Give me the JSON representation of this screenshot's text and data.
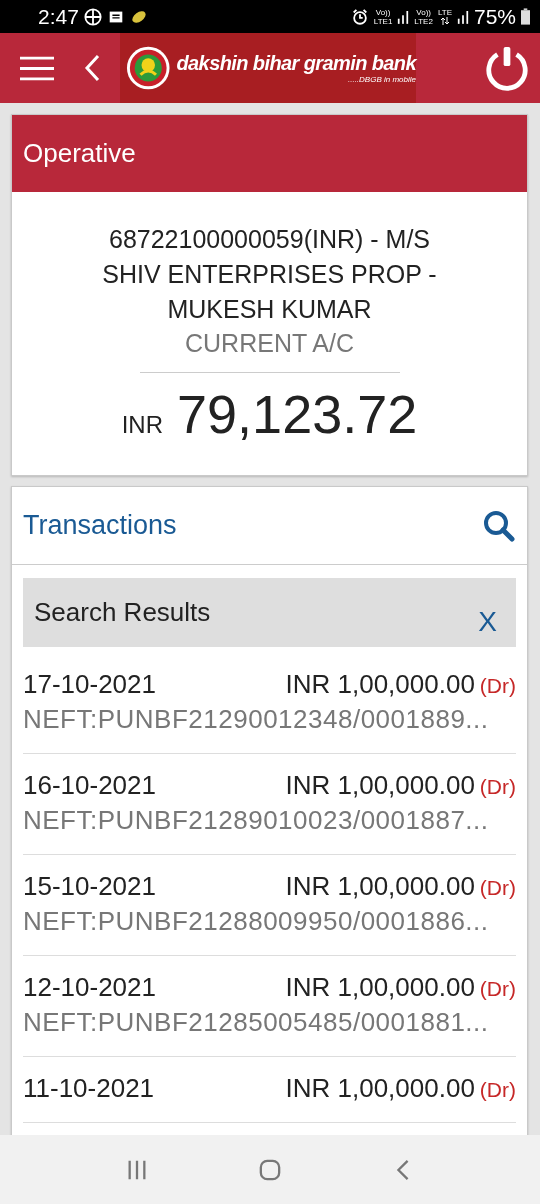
{
  "status_bar": {
    "time": "2:47",
    "sim1": {
      "voice": "Vo))",
      "network": "LTE1"
    },
    "sim2": {
      "voice": "Vo))",
      "network": "LTE2"
    },
    "data_network": "LTE",
    "battery": "75%"
  },
  "header": {
    "bank_name": "dakshin bihar gramin bank",
    "tagline": ".....DBGB in mobile"
  },
  "account_card": {
    "title": "Operative",
    "account": "68722100000059(INR) - M/S SHIV ENTERPRISES PROP - MUKESH KUMAR",
    "type": "CURRENT A/C",
    "currency": "INR",
    "balance": "79,123.72"
  },
  "transactions": {
    "title": "Transactions",
    "search_results": {
      "label": "Search Results",
      "close": "X"
    },
    "rows": [
      {
        "date": "17-10-2021",
        "amount": "INR 1,00,000.00",
        "type": "(Dr)",
        "description": "NEFT:PUNBF21290012348/0001889..."
      },
      {
        "date": "16-10-2021",
        "amount": "INR 1,00,000.00",
        "type": "(Dr)",
        "description": "NEFT:PUNBF21289010023/0001887..."
      },
      {
        "date": "15-10-2021",
        "amount": "INR 1,00,000.00",
        "type": "(Dr)",
        "description": "NEFT:PUNBF21288009950/0001886..."
      },
      {
        "date": "12-10-2021",
        "amount": "INR 1,00,000.00",
        "type": "(Dr)",
        "description": "NEFT:PUNBF21285005485/0001881..."
      },
      {
        "date": "11-10-2021",
        "amount": "INR 1,00,000.00",
        "type": "(Dr)"
      }
    ]
  }
}
